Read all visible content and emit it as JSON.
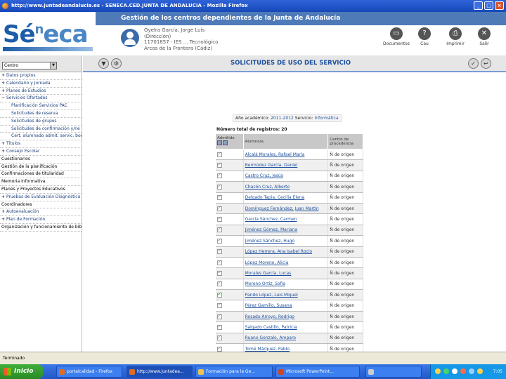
{
  "browser": {
    "title": "http://www.juntadeandalucia.es - SENECA.CED.JUNTA DE ANDALUCIA - Mozilla Firefox"
  },
  "header": {
    "banner": "Gestión de los centros dependientes de la Junta de Andalucía",
    "logo_prefix": "Sé",
    "logo_sup": "n",
    "logo_suffix": "eca",
    "user_lines": [
      "Oyelra García, Jorge Luis",
      "(Dirección)",
      "11701857 - IES ... Tecnológico",
      "Arcos de la Frontera (Cádiz)"
    ],
    "tools": [
      {
        "label": "Documentos",
        "icon": "documents-icon",
        "glyph": "▭"
      },
      {
        "label": "Cau",
        "icon": "help-icon",
        "glyph": "?"
      },
      {
        "label": "Imprimir",
        "icon": "printer-icon",
        "glyph": "⎙"
      },
      {
        "label": "Salir",
        "icon": "exit-icon",
        "glyph": "✕"
      }
    ]
  },
  "sidebar": {
    "select_value": "Centro",
    "items": [
      {
        "label": "Datos propios",
        "type": "plus"
      },
      {
        "label": "Calendario y Jornada",
        "type": "plus"
      },
      {
        "label": "Planes de Estudios",
        "type": "plus"
      },
      {
        "label": "Servicios Ofertados",
        "type": "minus"
      },
      {
        "label": "Planificación Servicios PAC",
        "type": "sub"
      },
      {
        "label": "Solicitudes de reserva",
        "type": "sub"
      },
      {
        "label": "Solicitudes de grupos",
        "type": "sub"
      },
      {
        "label": "Solicitudes de confirmación y/ne",
        "type": "sub"
      },
      {
        "label": "Cert. alumnado admit. servic. bonif.",
        "type": "sub"
      },
      {
        "label": "Títulos",
        "type": "plus"
      },
      {
        "label": "Consejo Escolar",
        "type": "plus"
      },
      {
        "label": "Cuestionarios",
        "type": "plain"
      },
      {
        "label": "Gestión de la planificación",
        "type": "plain"
      },
      {
        "label": "Confirmaciones de titularidad",
        "type": "plain"
      },
      {
        "label": "Memoria informativa",
        "type": "plain"
      },
      {
        "label": "Planes y Proyectos Educativos",
        "type": "plain"
      },
      {
        "label": "Pruebas de Evaluación Diagnóstica",
        "type": "plus"
      },
      {
        "label": "Coordinadores",
        "type": "plain"
      },
      {
        "label": "Autoevaluación",
        "type": "plus"
      },
      {
        "label": "Plan de Formación",
        "type": "plus"
      },
      {
        "label": "Organización y funcionamiento de bibl.",
        "type": "plain"
      }
    ]
  },
  "main": {
    "title": "SOLICITUDES DE USO DEL SERVICIO",
    "filter_label": "Año académico:",
    "filter_year": "2011-2012",
    "filter_service_label": "Servicio:",
    "filter_service": "Informática",
    "count_text": "Número total de registros: 20",
    "columns": [
      "Admitido",
      "Alumno/a",
      "Centro de procedencia"
    ],
    "rows": [
      {
        "admitted": true,
        "green": false,
        "student": "Alcalá Morales, Rafael María",
        "center": "Ñ de origen"
      },
      {
        "admitted": true,
        "green": false,
        "student": "Bermúdez García, Daniel",
        "center": "Ñ de origen"
      },
      {
        "admitted": true,
        "green": false,
        "student": "Castro Cruz, Jesús",
        "center": "Ñ de origen"
      },
      {
        "admitted": true,
        "green": false,
        "student": "Chacón Cruz, Alberto",
        "center": "Ñ de origen"
      },
      {
        "admitted": true,
        "green": false,
        "student": "Delgado Tapia, Cecilia Elena",
        "center": "Ñ de origen"
      },
      {
        "admitted": true,
        "green": false,
        "student": "Domínguez Fernández, Juan Martín",
        "center": "Ñ de origen"
      },
      {
        "admitted": true,
        "green": false,
        "student": "García Sánchez, Carmen",
        "center": "Ñ de origen"
      },
      {
        "admitted": true,
        "green": false,
        "student": "Jiménez Gómez, Mariana",
        "center": "Ñ de origen"
      },
      {
        "admitted": true,
        "green": false,
        "student": "Jiménez Sánchez, Hugo",
        "center": "Ñ de origen"
      },
      {
        "admitted": true,
        "green": false,
        "student": "López Herrera, Ana Isabel Rocío",
        "center": "Ñ de origen"
      },
      {
        "admitted": true,
        "green": false,
        "student": "López Moreno, Alicia",
        "center": "Ñ de origen"
      },
      {
        "admitted": true,
        "green": false,
        "student": "Morales García, Lucas",
        "center": "Ñ de origen"
      },
      {
        "admitted": true,
        "green": false,
        "student": "Moreno Ortiz, Sofía",
        "center": "Ñ de origen"
      },
      {
        "admitted": true,
        "green": true,
        "student": "Pando López, Luis Miguel",
        "center": "Ñ de origen"
      },
      {
        "admitted": true,
        "green": false,
        "student": "Pérez Gamillo, Susana",
        "center": "Ñ de origen"
      },
      {
        "admitted": true,
        "green": false,
        "student": "Rosado Arroyo, Rodrigo",
        "center": "Ñ de origen"
      },
      {
        "admitted": true,
        "green": false,
        "student": "Salgado Castillo, Patricia",
        "center": "Ñ de origen"
      },
      {
        "admitted": true,
        "green": false,
        "student": "Ruano Gonzalo, Amparo",
        "center": "Ñ de origen"
      },
      {
        "admitted": true,
        "green": false,
        "student": "Tomé Márquez, Pablo",
        "center": "Ñ de origen"
      }
    ]
  },
  "status": {
    "text": "Terminado"
  },
  "taskbar": {
    "start": "Inicio",
    "tasks": [
      {
        "label": "portalcalidad - Firefox",
        "color": "#e46a1f"
      },
      {
        "label": "http://www.juntadea...",
        "color": "#e46a1f"
      },
      {
        "label": "Formación para la Ge...",
        "color": "#f2c14e"
      },
      {
        "label": "Microsoft PowerPoint...",
        "color": "#d2451e"
      },
      {
        "label": "",
        "color": "#cccccc"
      }
    ],
    "clock": "7:05"
  },
  "colors": {
    "brand": "#1c5ca8",
    "banner": "#4f7ab8",
    "title_bar": "#1648b8"
  }
}
